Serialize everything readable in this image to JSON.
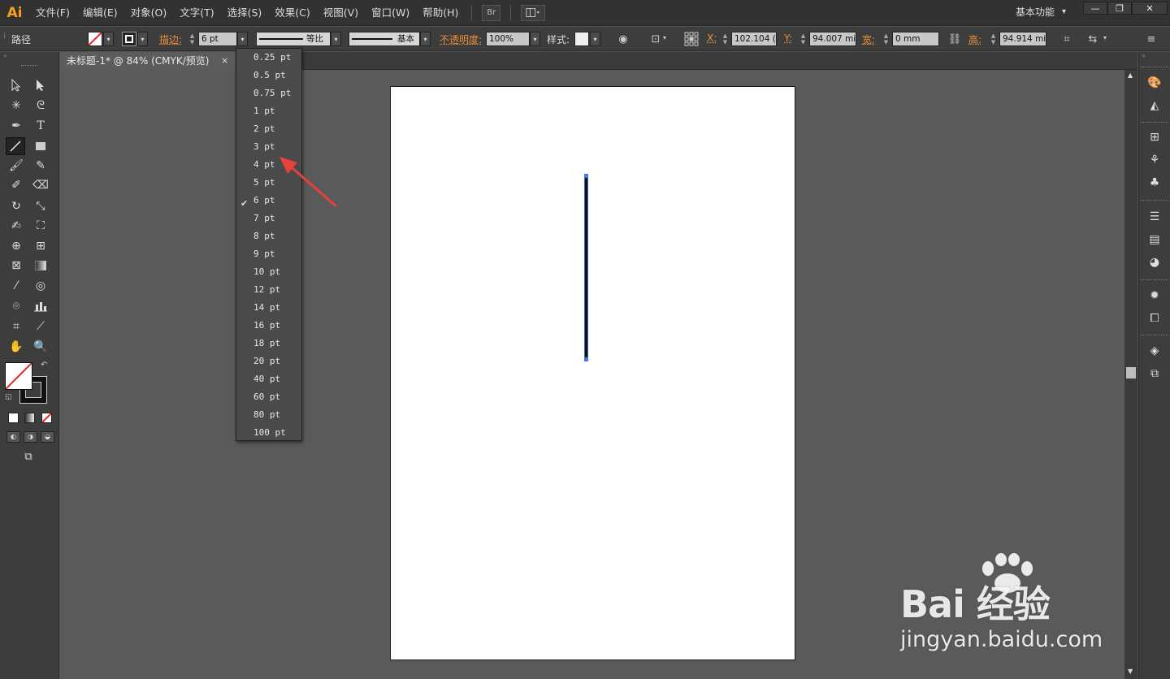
{
  "app": {
    "logo": "Ai"
  },
  "menu": [
    "文件(F)",
    "编辑(E)",
    "对象(O)",
    "文字(T)",
    "选择(S)",
    "效果(C)",
    "视图(V)",
    "窗口(W)",
    "帮助(H)"
  ],
  "menu_bridge": "Br",
  "workspace": "基本功能",
  "window_buttons": {
    "minimize": "—",
    "restore": "❐",
    "close": "✕"
  },
  "control": {
    "selection_type": "路径",
    "stroke_label": "描边:",
    "stroke_value": "6 pt",
    "profile_label": "等比",
    "brush_label": "基本",
    "opacity_label": "不透明度:",
    "opacity_value": "100%",
    "style_label": "样式:",
    "x_label": "X:",
    "x_value": "102.104 (",
    "y_label": "Y:",
    "y_value": "94.007 mi",
    "w_label": "宽:",
    "w_value": "0 mm",
    "h_label": "高:",
    "h_value": "94.914 mi"
  },
  "document": {
    "tab_title": "未标题-1* @ 84% (CMYK/预览)",
    "close": "×"
  },
  "stroke_options": [
    "0.25 pt",
    "0.5 pt",
    "0.75 pt",
    "1 pt",
    "2 pt",
    "3 pt",
    "4 pt",
    "5 pt",
    "6 pt",
    "7 pt",
    "8 pt",
    "9 pt",
    "10 pt",
    "12 pt",
    "14 pt",
    "16 pt",
    "18 pt",
    "20 pt",
    "40 pt",
    "60 pt",
    "80 pt",
    "100 pt"
  ],
  "stroke_selected": "6 pt",
  "check_mark": "✔",
  "accent_colors": {
    "ai_orange": "#f7a01d",
    "label_orange": "#e8903a",
    "annotation_arrow": "#e8403a",
    "selection_blue": "#4a78e0"
  },
  "watermark": {
    "brand": "Bai 经验",
    "url": "jingyan.baidu.com"
  }
}
